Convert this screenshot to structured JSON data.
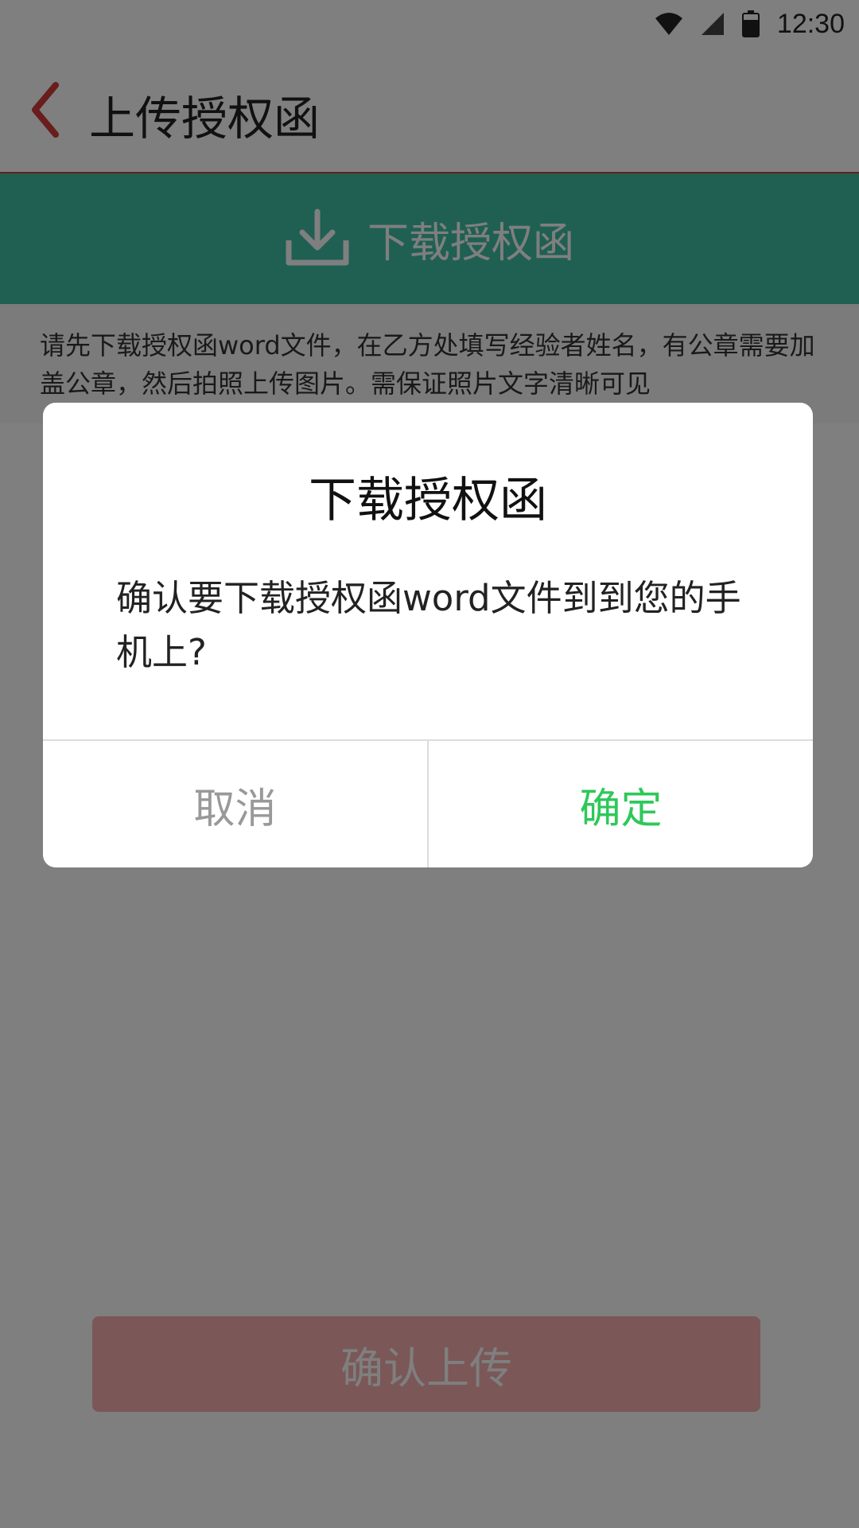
{
  "status_bar": {
    "time": "12:30"
  },
  "header": {
    "title": "上传授权函"
  },
  "download_banner": {
    "label": "下载授权函"
  },
  "instruction": {
    "text": "请先下载授权函word文件，在乙方处填写经验者姓名，有公章需要加盖公章，然后拍照上传图片。需保证照片文字清晰可见"
  },
  "footer": {
    "confirm_upload_label": "确认上传"
  },
  "dialog": {
    "title": "下载授权函",
    "message": "确认要下载授权函word文件到到您的手机上?",
    "cancel_label": "取消",
    "ok_label": "确定"
  },
  "colors": {
    "accent_red": "#d33a3a",
    "banner_green": "#3fc1a7",
    "ok_green": "#2ec85a",
    "upload_button": "#f6aeb0"
  },
  "icons": [
    "wifi-icon",
    "signal-icon",
    "battery-icon",
    "back-arrow-icon",
    "download-icon"
  ]
}
